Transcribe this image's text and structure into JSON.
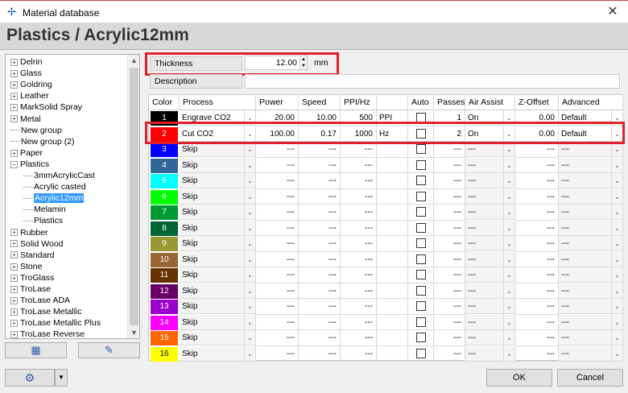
{
  "window": {
    "title": "Material database",
    "icons": {
      "app": "material-db-icon",
      "close": "close-icon"
    }
  },
  "header": {
    "title": "Plastics / Acrylic12mm"
  },
  "tree": {
    "items": [
      {
        "label": "Delrin",
        "level": 0,
        "expandable": true
      },
      {
        "label": "Glass",
        "level": 0,
        "expandable": true
      },
      {
        "label": "Goldring",
        "level": 0,
        "expandable": true
      },
      {
        "label": "Leather",
        "level": 0,
        "expandable": true
      },
      {
        "label": "MarkSolid Spray",
        "level": 0,
        "expandable": true
      },
      {
        "label": "Metal",
        "level": 0,
        "expandable": true
      },
      {
        "label": "New group",
        "level": 0,
        "expandable": false
      },
      {
        "label": "New group (2)",
        "level": 0,
        "expandable": false
      },
      {
        "label": "Paper",
        "level": 0,
        "expandable": true
      },
      {
        "label": "Plastics",
        "level": 0,
        "expandable": true,
        "expanded": true
      },
      {
        "label": "3mmAcrylicCast",
        "level": 1,
        "expandable": false
      },
      {
        "label": "Acrylic casted",
        "level": 1,
        "expandable": false
      },
      {
        "label": "Acrylic12mm",
        "level": 1,
        "expandable": false,
        "selected": true
      },
      {
        "label": "Melamin",
        "level": 1,
        "expandable": false
      },
      {
        "label": "Plastics",
        "level": 1,
        "expandable": false
      },
      {
        "label": "Rubber",
        "level": 0,
        "expandable": true
      },
      {
        "label": "Solid Wood",
        "level": 0,
        "expandable": true
      },
      {
        "label": "Standard",
        "level": 0,
        "expandable": true
      },
      {
        "label": "Stone",
        "level": 0,
        "expandable": true
      },
      {
        "label": "TroGlass",
        "level": 0,
        "expandable": true
      },
      {
        "label": "TroLase",
        "level": 0,
        "expandable": true
      },
      {
        "label": "TroLase ADA",
        "level": 0,
        "expandable": true
      },
      {
        "label": "TroLase Metallic",
        "level": 0,
        "expandable": true
      },
      {
        "label": "TroLase Metallic Plus",
        "level": 0,
        "expandable": true
      },
      {
        "label": "TroLase Reverse",
        "level": 0,
        "expandable": true
      }
    ],
    "buttons": {
      "add_material_icon": "add-material-icon",
      "add_group_icon": "add-group-icon"
    }
  },
  "fields": {
    "thickness_label": "Thickness",
    "thickness_value": "12.00",
    "thickness_unit": "mm",
    "description_label": "Description",
    "description_value": ""
  },
  "table": {
    "headers": [
      "Color",
      "Process",
      "Power",
      "Speed",
      "PPI/Hz",
      "",
      "Auto",
      "Passes",
      "Air Assist",
      "Z-Offset",
      "Advanced"
    ],
    "rows": [
      {
        "num": "1",
        "color": "#000000",
        "fg": "#ffffff",
        "process": "Engrave CO2",
        "power": "20.00",
        "speed": "10.00",
        "ppi": "500",
        "unit": "PPI",
        "auto": false,
        "passes": "1",
        "air": "On",
        "z": "0.00",
        "adv": "Default"
      },
      {
        "num": "2",
        "color": "#ff0000",
        "fg": "#ffffff",
        "process": "Cut CO2",
        "power": "100.00",
        "speed": "0.17",
        "ppi": "1000",
        "unit": "Hz",
        "auto": false,
        "passes": "2",
        "air": "On",
        "z": "0.00",
        "adv": "Default"
      },
      {
        "num": "3",
        "color": "#0000ff",
        "fg": "#ffffff",
        "process": "Skip",
        "power": "---",
        "speed": "---",
        "ppi": "---",
        "unit": "",
        "auto": false,
        "passes": "---",
        "air": "---",
        "z": "---",
        "adv": "---"
      },
      {
        "num": "4",
        "color": "#336699",
        "fg": "#ffffff",
        "process": "Skip",
        "power": "---",
        "speed": "---",
        "ppi": "---",
        "unit": "",
        "auto": false,
        "passes": "---",
        "air": "---",
        "z": "---",
        "adv": "---"
      },
      {
        "num": "5",
        "color": "#00ffff",
        "fg": "#ffffff",
        "process": "Skip",
        "power": "---",
        "speed": "---",
        "ppi": "---",
        "unit": "",
        "auto": false,
        "passes": "---",
        "air": "---",
        "z": "---",
        "adv": "---"
      },
      {
        "num": "6",
        "color": "#00ff00",
        "fg": "#ffffff",
        "process": "Skip",
        "power": "---",
        "speed": "---",
        "ppi": "---",
        "unit": "",
        "auto": false,
        "passes": "---",
        "air": "---",
        "z": "---",
        "adv": "---"
      },
      {
        "num": "7",
        "color": "#009933",
        "fg": "#ffffff",
        "process": "Skip",
        "power": "---",
        "speed": "---",
        "ppi": "---",
        "unit": "",
        "auto": false,
        "passes": "---",
        "air": "---",
        "z": "---",
        "adv": "---"
      },
      {
        "num": "8",
        "color": "#006633",
        "fg": "#ffffff",
        "process": "Skip",
        "power": "---",
        "speed": "---",
        "ppi": "---",
        "unit": "",
        "auto": false,
        "passes": "---",
        "air": "---",
        "z": "---",
        "adv": "---"
      },
      {
        "num": "9",
        "color": "#999933",
        "fg": "#ffffff",
        "process": "Skip",
        "power": "---",
        "speed": "---",
        "ppi": "---",
        "unit": "",
        "auto": false,
        "passes": "---",
        "air": "---",
        "z": "---",
        "adv": "---"
      },
      {
        "num": "10",
        "color": "#996633",
        "fg": "#ffffff",
        "process": "Skip",
        "power": "---",
        "speed": "---",
        "ppi": "---",
        "unit": "",
        "auto": false,
        "passes": "---",
        "air": "---",
        "z": "---",
        "adv": "---"
      },
      {
        "num": "11",
        "color": "#663300",
        "fg": "#ffffff",
        "process": "Skip",
        "power": "---",
        "speed": "---",
        "ppi": "---",
        "unit": "",
        "auto": false,
        "passes": "---",
        "air": "---",
        "z": "---",
        "adv": "---"
      },
      {
        "num": "12",
        "color": "#660066",
        "fg": "#ffffff",
        "process": "Skip",
        "power": "---",
        "speed": "---",
        "ppi": "---",
        "unit": "",
        "auto": false,
        "passes": "---",
        "air": "---",
        "z": "---",
        "adv": "---"
      },
      {
        "num": "13",
        "color": "#9900cc",
        "fg": "#ffffff",
        "process": "Skip",
        "power": "---",
        "speed": "---",
        "ppi": "---",
        "unit": "",
        "auto": false,
        "passes": "---",
        "air": "---",
        "z": "---",
        "adv": "---"
      },
      {
        "num": "14",
        "color": "#ff00ff",
        "fg": "#ffffff",
        "process": "Skip",
        "power": "---",
        "speed": "---",
        "ppi": "---",
        "unit": "",
        "auto": false,
        "passes": "---",
        "air": "---",
        "z": "---",
        "adv": "---"
      },
      {
        "num": "15",
        "color": "#ff6600",
        "fg": "#ffffff",
        "process": "Skip",
        "power": "---",
        "speed": "---",
        "ppi": "---",
        "unit": "",
        "auto": false,
        "passes": "---",
        "air": "---",
        "z": "---",
        "adv": "---"
      },
      {
        "num": "16",
        "color": "#ffff00",
        "fg": "#000000",
        "process": "Skip",
        "power": "---",
        "speed": "---",
        "ppi": "---",
        "unit": "",
        "auto": false,
        "passes": "---",
        "air": "---",
        "z": "---",
        "adv": "---"
      }
    ]
  },
  "footer": {
    "settings_icon": "gear-icon",
    "ok_label": "OK",
    "cancel_label": "Cancel"
  },
  "colors": {
    "highlight": "#e0202a",
    "selection": "#3399ff"
  }
}
